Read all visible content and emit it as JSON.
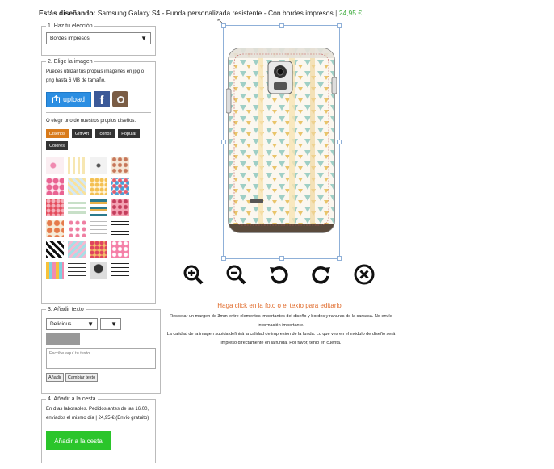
{
  "header": {
    "prefix": "Estás diseñando:",
    "product": "Samsung Galaxy S4 - Funda personalizada resistente - Con bordes impresos",
    "separator": "|",
    "price": "24,95 €",
    "price_color": "#3bab3b"
  },
  "step1": {
    "legend": "1. Haz tu elección",
    "select_value": "Bordes impresos"
  },
  "step2": {
    "legend": "2. Elige la imagen",
    "intro": "Puedes utilizar tus propias imágenes en jpg o png hasta 6 MB de tamaño.",
    "upload_label": "upload",
    "facebook_glyph": "f",
    "or_choose": "O elegir uno de nuestros propios diseños.",
    "categories": [
      "Diseños",
      "Gift/Art",
      "Iconos",
      "Popular",
      "Colores"
    ],
    "active_category_color": "#d87a1a"
  },
  "step3": {
    "legend": "3. Añadir texto",
    "font_value": "Delicious",
    "size_value": "",
    "text_placeholder": "Escribe aquí tu texto...",
    "add_label": "Añadir",
    "change_label": "Cambiar texto"
  },
  "step4": {
    "legend": "4. Añadir a la cesta",
    "delivery": "En días laborables. Pedidos antes de las 16.00, enviados el mismo día | 24,95 € (Envío gratuito)",
    "cart_button": "Añadir a la cesta",
    "cart_color": "#2bc52b"
  },
  "editor": {
    "hint": "Haga click en la foto o el texto para editarlo",
    "hint_color": "#e06a2a",
    "info_line1": "Respetar un margen de 3mm entre elementos importantes del diseño y bordes y ranuras de la carcasa. No envíe información importante.",
    "info_line2": "La calidad de la imagen subida definirá la calidad de impresión de la funda. Lo que ves en el módulo de diseño será impreso directamente en la funda. Por favor, tenlo en cuenta.",
    "tools": [
      "zoom-in-icon",
      "zoom-out-icon",
      "rotate-left-icon",
      "rotate-right-icon",
      "delete-icon"
    ]
  }
}
